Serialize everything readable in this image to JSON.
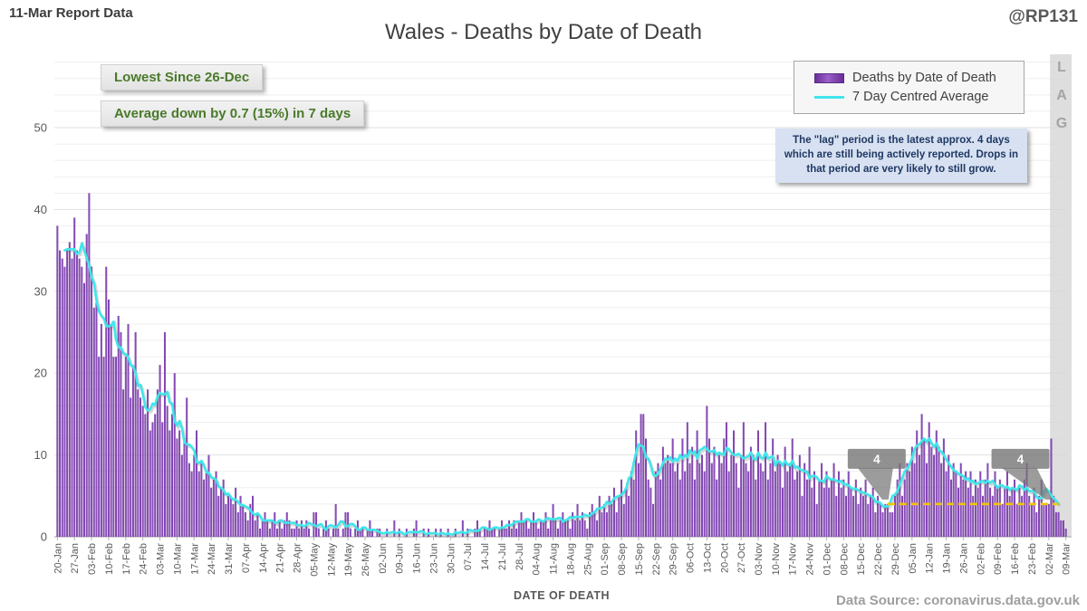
{
  "header": {
    "report_label": "11-Mar Report Data",
    "title": "Wales - Deaths by Date of Death",
    "handle": "@RP131"
  },
  "annotations": {
    "lowest": "Lowest Since 26-Dec",
    "average_change": "Average down by 0.7 (15%) in 7 days",
    "lag_note": "The \"lag\" period is the latest approx. 4 days which are still being actively reported. Drops in that period are very likely to still grow.",
    "lag_letters": [
      "L",
      "A",
      "G"
    ]
  },
  "legend": {
    "items": [
      {
        "label": "Deaths by Date of Death",
        "swatch": "bar"
      },
      {
        "label": "7 Day Centred Average",
        "swatch": "line"
      }
    ]
  },
  "axes": {
    "x_label": "DATE OF DEATH",
    "y_ticks": [
      0,
      10,
      20,
      30,
      40,
      50
    ],
    "x_tick_labels": [
      "20-Jan",
      "27-Jan",
      "03-Feb",
      "10-Feb",
      "17-Feb",
      "24-Feb",
      "03-Mar",
      "10-Mar",
      "17-Mar",
      "24-Mar",
      "31-Mar",
      "07-Apr",
      "14-Apr",
      "21-Apr",
      "28-Apr",
      "05-May",
      "12-May",
      "19-May",
      "26-May",
      "02-Jun",
      "09-Jun",
      "16-Jun",
      "23-Jun",
      "30-Jun",
      "07-Jul",
      "14-Jul",
      "21-Jul",
      "28-Jul",
      "04-Aug",
      "11-Aug",
      "18-Aug",
      "25-Aug",
      "01-Sep",
      "08-Sep",
      "15-Sep",
      "22-Sep",
      "29-Sep",
      "06-Oct",
      "13-Oct",
      "20-Oct",
      "27-Oct",
      "03-Nov",
      "10-Nov",
      "17-Nov",
      "24-Nov",
      "01-Dec",
      "08-Dec",
      "15-Dec",
      "22-Dec",
      "29-Dec",
      "05-Jan",
      "12-Jan",
      "19-Jan",
      "26-Jan",
      "02-Feb",
      "09-Feb",
      "16-Feb",
      "23-Feb",
      "02-Mar",
      "09-Mar"
    ]
  },
  "footer": {
    "data_source": "Data Source: coronavirus.data.gov.uk"
  },
  "colors": {
    "bar": "#7E3DB0",
    "bar_light": "#9A5FC8",
    "bar_dark": "#6A2D99",
    "line": "#3FE6EC",
    "reference": "#F2C500",
    "green_text": "#4A7A2A",
    "lag_note_bg": "#D7E1F1",
    "lag_note_text": "#1F3864",
    "grid": "#EDEDED"
  },
  "chart_data": {
    "type": "bar",
    "title": "Wales - Deaths by Date of Death",
    "xlabel": "DATE OF DEATH",
    "ylabel": "",
    "x_start": "20-Jan",
    "x_end": "09-Mar",
    "x_unit": "day",
    "x_tick_every_days": 7,
    "ylim": [
      0,
      58
    ],
    "gridline_step": 2,
    "legend_position": "top-right",
    "series": [
      {
        "name": "Deaths by Date of Death",
        "type": "bar"
      },
      {
        "name": "7 Day Centred Average",
        "type": "line",
        "derivation": "7-day centred mean of bar values",
        "latest_value": 4,
        "change_in_7_days": "-0.7 (-15%)"
      }
    ],
    "values": [
      38,
      35,
      34,
      33,
      35,
      36,
      34,
      39,
      35,
      34,
      33,
      31,
      37,
      42,
      33,
      28,
      29,
      22,
      26,
      22,
      33,
      29,
      26,
      22,
      22,
      27,
      25,
      18,
      22,
      26,
      17,
      21,
      25,
      18,
      17,
      16,
      15,
      18,
      13,
      14,
      15,
      18,
      21,
      14,
      25,
      16,
      13,
      15,
      20,
      12,
      13,
      10,
      12,
      17,
      9,
      8,
      10,
      13,
      8,
      9,
      7,
      8,
      10,
      6,
      7,
      8,
      5,
      6,
      7,
      4,
      5,
      5,
      4,
      6,
      3,
      5,
      4,
      3,
      2,
      4,
      5,
      2,
      3,
      1,
      2,
      3,
      2,
      1,
      2,
      3,
      1,
      2,
      1,
      2,
      3,
      2,
      1,
      1,
      2,
      1,
      2,
      1,
      2,
      1,
      0,
      3,
      3,
      1,
      0,
      1,
      2,
      1,
      0,
      1,
      4,
      1,
      0,
      1,
      3,
      3,
      1,
      0,
      1,
      2,
      1,
      1,
      0,
      1,
      2,
      1,
      0,
      1,
      1,
      0,
      0,
      1,
      0,
      0,
      2,
      0,
      1,
      0,
      0,
      1,
      0,
      0,
      1,
      2,
      0,
      0,
      1,
      0,
      1,
      0,
      0,
      1,
      0,
      1,
      0,
      0,
      1,
      0,
      0,
      1,
      0,
      0,
      2,
      0,
      1,
      0,
      0,
      1,
      2,
      1,
      0,
      1,
      1,
      2,
      1,
      1,
      0,
      1,
      2,
      1,
      1,
      2,
      1,
      2,
      1,
      2,
      3,
      2,
      2,
      1,
      2,
      3,
      2,
      1,
      2,
      2,
      3,
      1,
      2,
      4,
      2,
      1,
      2,
      3,
      2,
      2,
      1,
      3,
      2,
      4,
      2,
      3,
      2,
      1,
      3,
      4,
      3,
      2,
      5,
      3,
      4,
      3,
      5,
      4,
      6,
      3,
      5,
      7,
      4,
      6,
      5,
      8,
      7,
      13,
      9,
      15,
      15,
      12,
      7,
      6,
      4,
      8,
      9,
      7,
      11,
      9,
      10,
      9,
      12,
      8,
      9,
      7,
      12,
      8,
      14,
      9,
      11,
      7,
      13,
      9,
      10,
      8,
      16,
      12,
      9,
      11,
      7,
      10,
      9,
      12,
      14,
      8,
      10,
      13,
      9,
      6,
      10,
      14,
      9,
      8,
      11,
      10,
      7,
      13,
      9,
      8,
      14,
      7,
      9,
      12,
      8,
      10,
      9,
      6,
      11,
      8,
      9,
      12,
      7,
      8,
      10,
      5,
      9,
      7,
      11,
      6,
      8,
      4,
      7,
      9,
      6,
      8,
      6,
      7,
      9,
      5,
      8,
      6,
      7,
      5,
      8,
      6,
      5,
      7,
      4,
      6,
      5,
      7,
      4,
      5,
      6,
      3,
      5,
      4,
      3,
      4,
      4,
      3,
      3,
      5,
      7,
      9,
      5,
      7,
      9,
      8,
      11,
      9,
      13,
      10,
      15,
      12,
      9,
      14,
      11,
      10,
      13,
      11,
      9,
      12,
      8,
      10,
      7,
      9,
      8,
      6,
      9,
      7,
      8,
      6,
      8,
      5,
      7,
      6,
      8,
      5,
      7,
      9,
      6,
      5,
      8,
      6,
      7,
      4,
      6,
      8,
      5,
      6,
      7,
      4,
      6,
      5,
      7,
      9,
      5,
      4,
      6,
      3,
      5,
      7,
      4,
      4,
      4,
      12,
      5,
      3,
      3,
      2,
      2,
      1
    ],
    "reference_line": {
      "y": 4,
      "from_index": 340,
      "to_index": 410,
      "style": "dashed"
    },
    "callouts": [
      {
        "index": 340,
        "label": "4",
        "dx": -12,
        "tip_dx": -4
      },
      {
        "index": 410,
        "label": "4",
        "dx": -42,
        "tip_dx": -12
      }
    ],
    "lag_band": {
      "from_index": 407
    }
  }
}
